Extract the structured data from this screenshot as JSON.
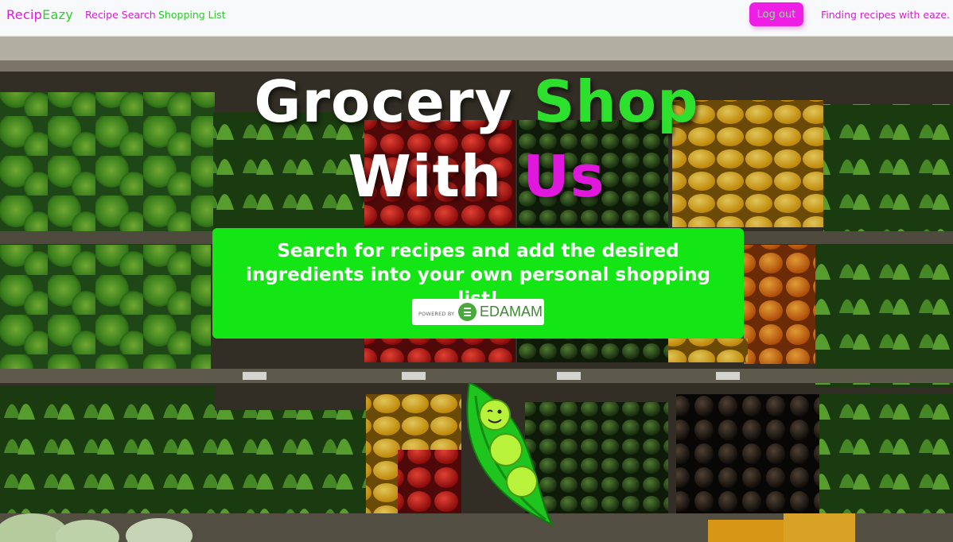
{
  "navbar": {
    "brand_part1": "Recip",
    "brand_part2": "Eazy",
    "links": [
      "Recipe Search",
      "Shopping List"
    ],
    "logout_label": "Log out",
    "tagline": "Finding recipes with eaze."
  },
  "hero": {
    "line1_word1": "Grocery",
    "line1_word2": "Shop",
    "line2_word1": "With",
    "line2_word2": "Us"
  },
  "info": {
    "text": "Search for recipes and add the desired ingredients into your own personal shopping list!",
    "badge_powered": "POWERED BY",
    "badge_name": "EDAMAM"
  },
  "colors": {
    "brand_pink": "#e21ad8",
    "brand_green": "#2fd02f",
    "card_green": "#14e514",
    "logout_bg": "#ee1ee5"
  },
  "icons": [
    "edamam-logo-icon",
    "pea-mascot-icon"
  ]
}
